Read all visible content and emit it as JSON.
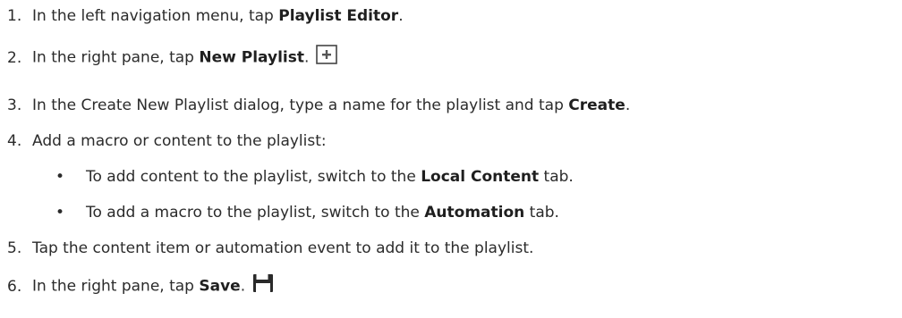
{
  "steps": [
    {
      "num": "1.",
      "pre": "In the left navigation menu, tap ",
      "bold": "Playlist Editor",
      "post": "."
    },
    {
      "num": "2.",
      "pre": "In the right pane, tap ",
      "bold": "New Playlist",
      "post": ".",
      "icon": "new-playlist-plus-icon"
    },
    {
      "num": "3.",
      "pre": "In the Create New Playlist dialog, type a name for the playlist and tap ",
      "bold": "Create",
      "post": "."
    },
    {
      "num": "4.",
      "pre": "Add a macro or content to the playlist:",
      "bold": "",
      "post": ""
    },
    {
      "num": "5.",
      "pre": "Tap the content item or automation event to add it to the playlist.",
      "bold": "",
      "post": ""
    },
    {
      "num": "6.",
      "pre": "In the right pane, tap ",
      "bold": "Save",
      "post": ".",
      "icon": "save-floppy-icon"
    }
  ],
  "bullets": [
    {
      "bullet": "•",
      "pre": "To add content to the playlist, switch to the ",
      "bold": "Local Content",
      "post": " tab."
    },
    {
      "bullet": "•",
      "pre": "To add a macro to the playlist, switch to the ",
      "bold": "Automation",
      "post": " tab."
    }
  ]
}
